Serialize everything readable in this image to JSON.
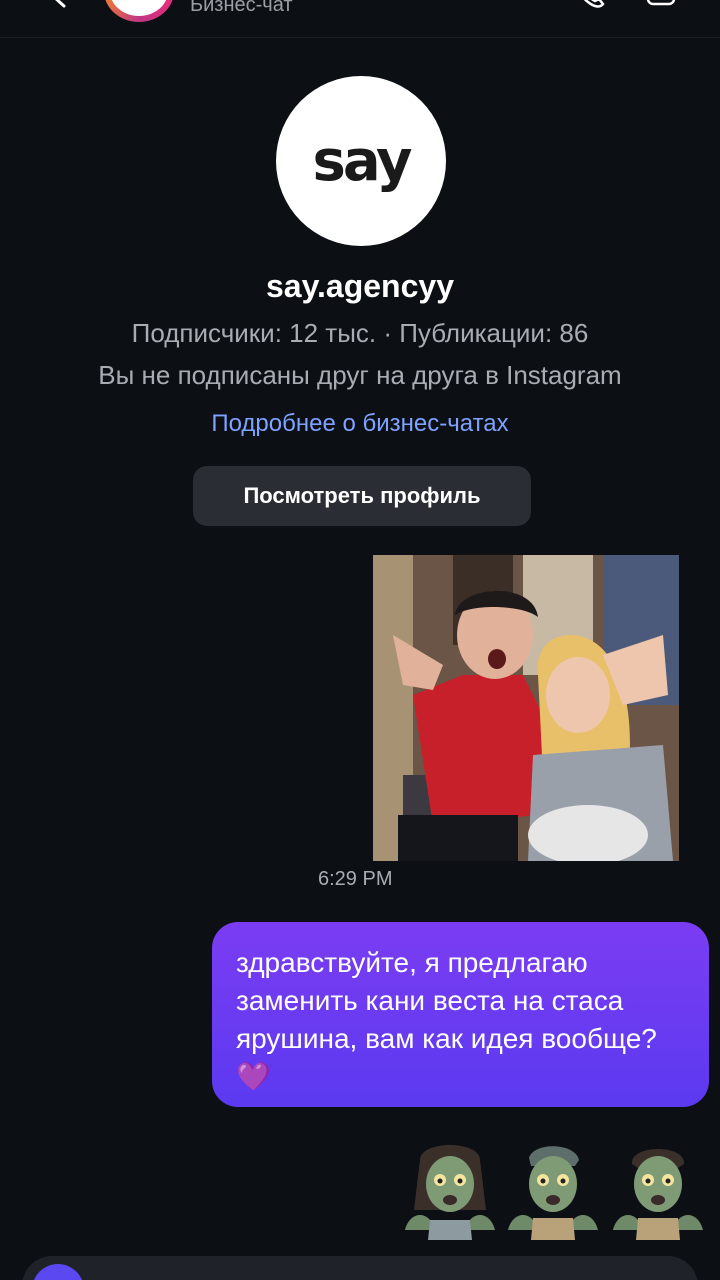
{
  "header": {
    "subtitle": "Бизнес-чат",
    "icons": [
      "back-icon",
      "phone-icon",
      "video-camera-icon"
    ]
  },
  "profile": {
    "logo": "say",
    "name": "say.agencyy",
    "stats": "Подписчики: 12 тыс. · Публикации: 86",
    "follow_status": "Вы не подписаны друг на друга в Instagram",
    "learn_more": "Подробнее о бизнес-чатах",
    "view_profile_button": "Посмотреть профиль"
  },
  "messages": {
    "photo_time": "6:29 PM",
    "text": "здравствуйте, я предлагаю заменить кани веста на стаса ярушина, вам как идея вообще?",
    "emoji": "💜",
    "stickers": [
      "zombie-woman",
      "zombie-man",
      "zombie"
    ]
  },
  "colors": {
    "background": "#0c0f14",
    "bubble": "#6a3bf1",
    "link": "#7ea2ff",
    "muted_text": "#a8adb4"
  }
}
